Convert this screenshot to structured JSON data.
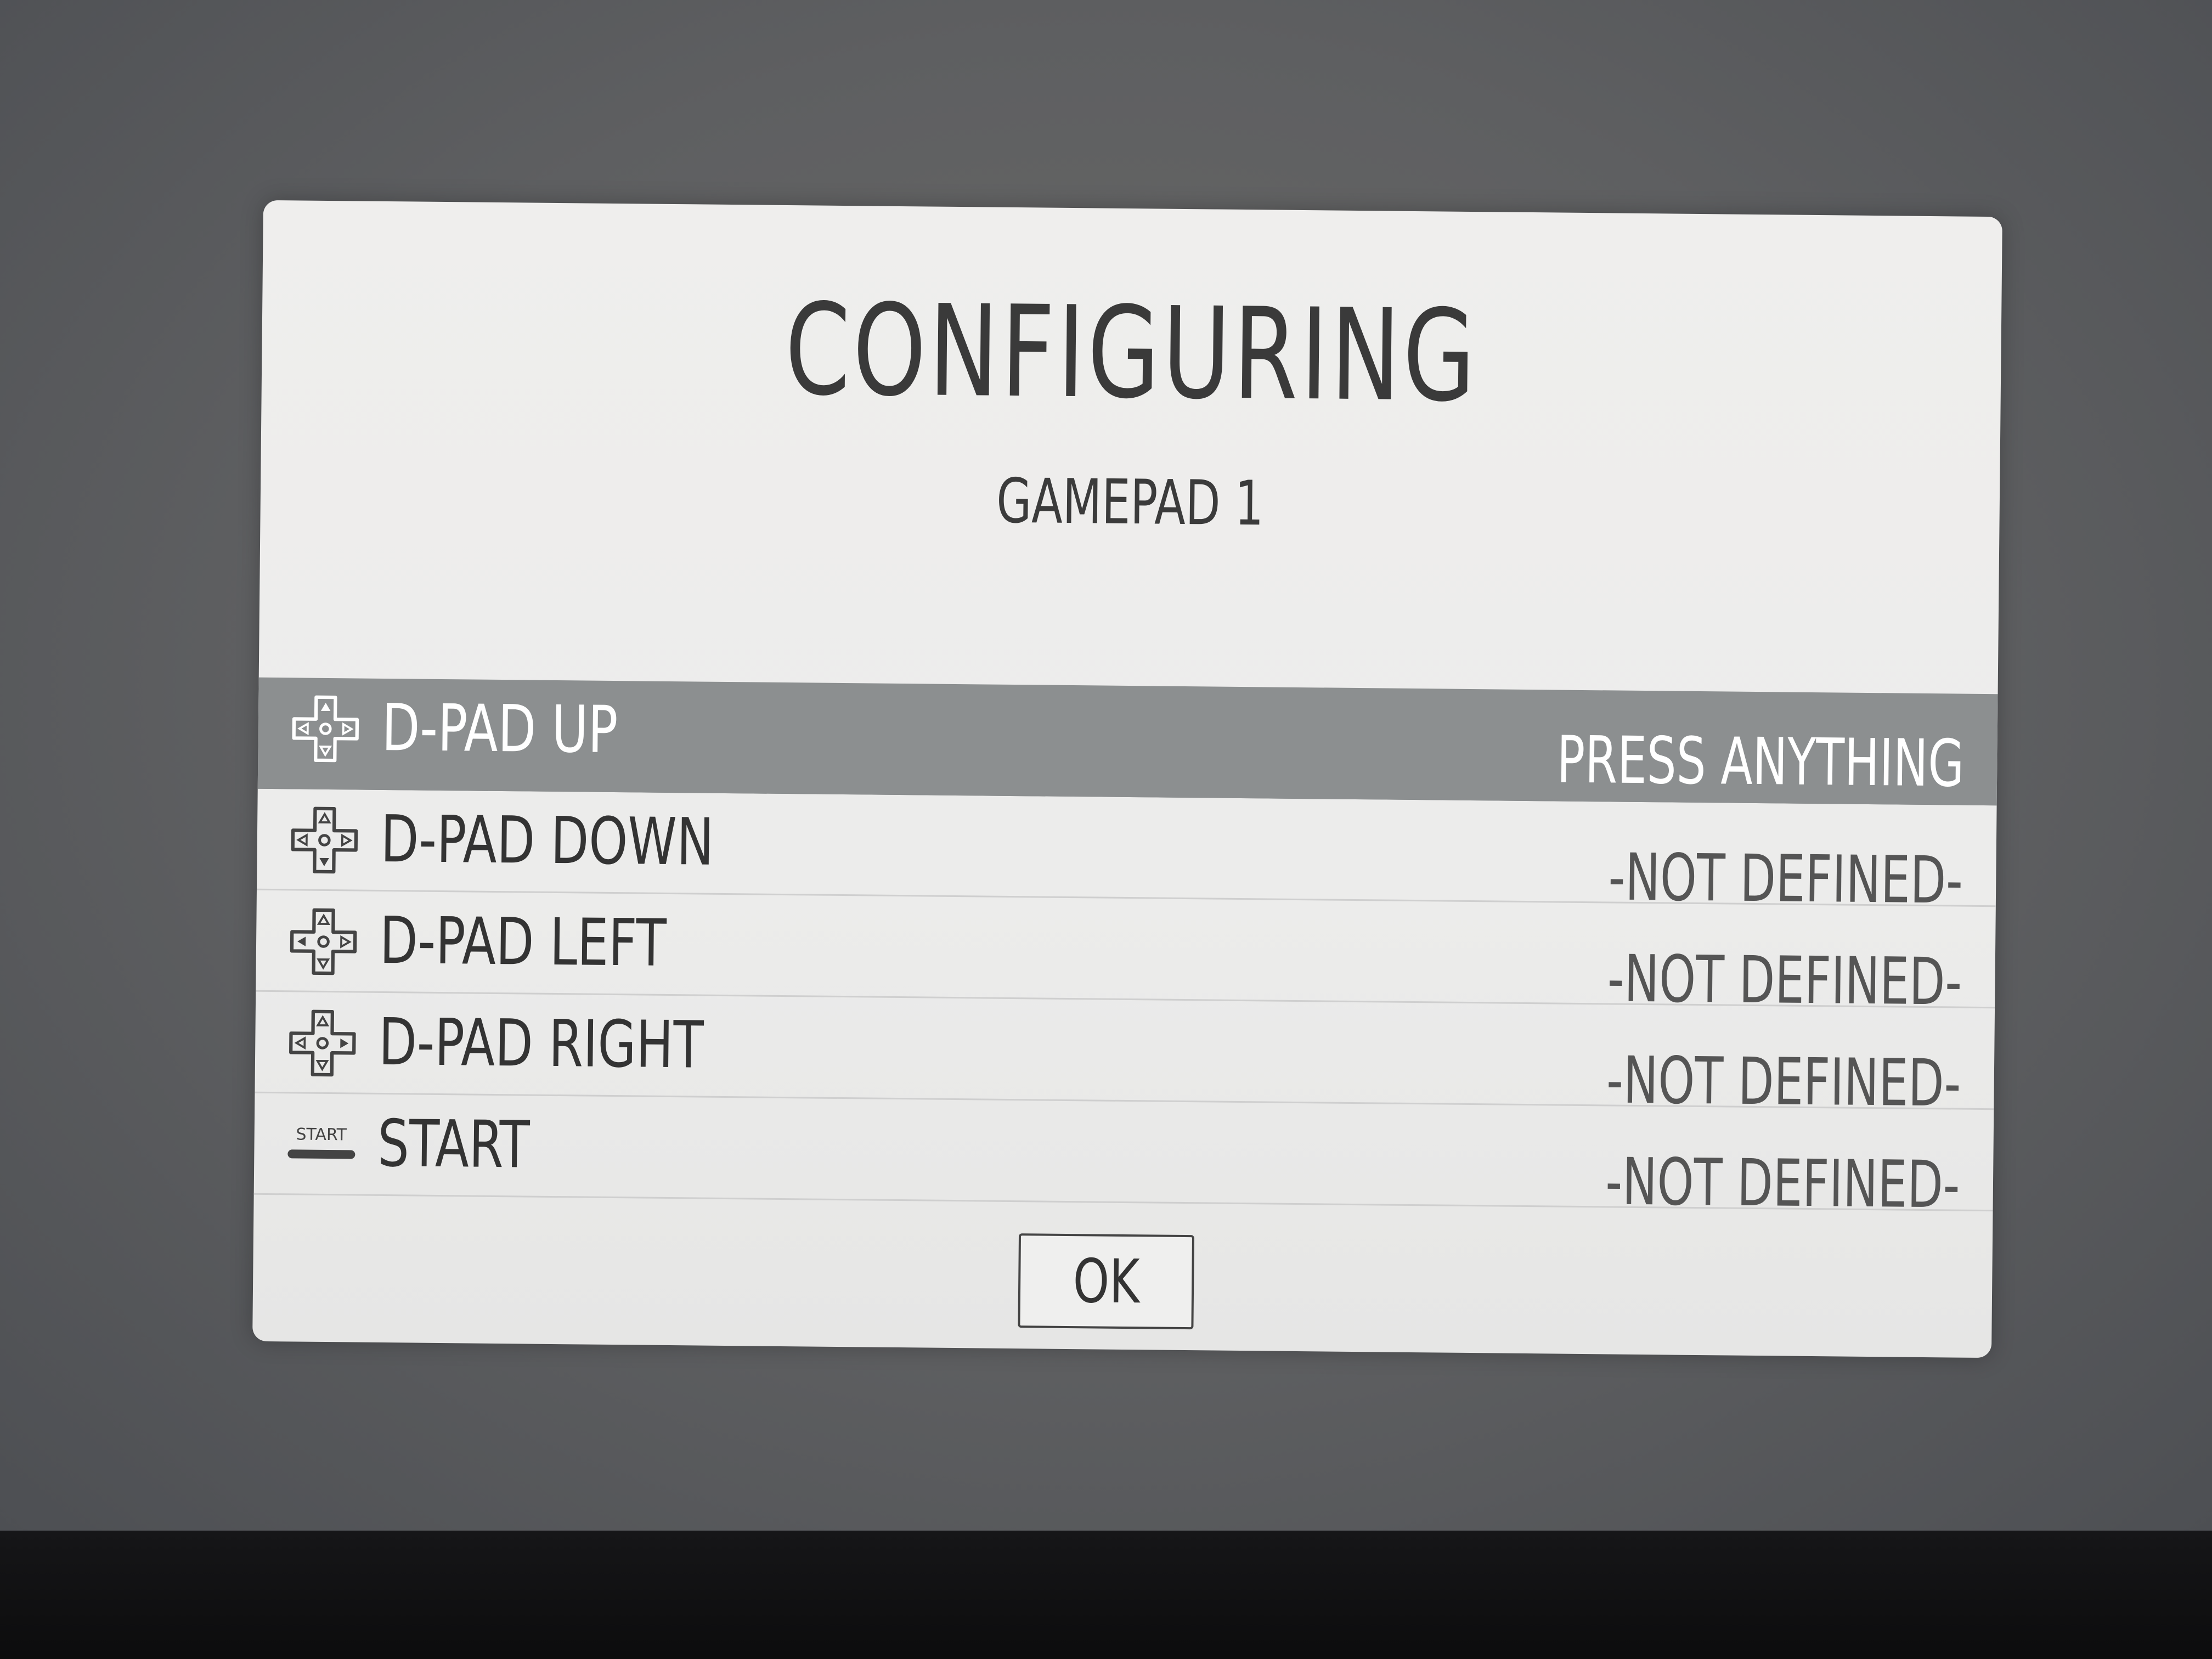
{
  "dialog": {
    "title": "CONFIGURING",
    "subtitle": "GAMEPAD 1"
  },
  "inputs": [
    {
      "label": "D-PAD UP",
      "value": "PRESS ANYTHING",
      "icon": "dpad-up-icon",
      "selected": true
    },
    {
      "label": "D-PAD DOWN",
      "value": "-NOT DEFINED-",
      "icon": "dpad-down-icon",
      "selected": false
    },
    {
      "label": "D-PAD LEFT",
      "value": "-NOT DEFINED-",
      "icon": "dpad-left-icon",
      "selected": false
    },
    {
      "label": "D-PAD RIGHT",
      "value": "-NOT DEFINED-",
      "icon": "dpad-right-icon",
      "selected": false
    },
    {
      "label": "START",
      "value": "-NOT DEFINED-",
      "icon": "start-button-icon",
      "selected": false,
      "icon_text": "START"
    }
  ],
  "ok_button": {
    "label": "OK"
  },
  "colors": {
    "selected_row": "#8c8f90",
    "dialog_bg": "#eeeeed",
    "text": "#333333"
  }
}
